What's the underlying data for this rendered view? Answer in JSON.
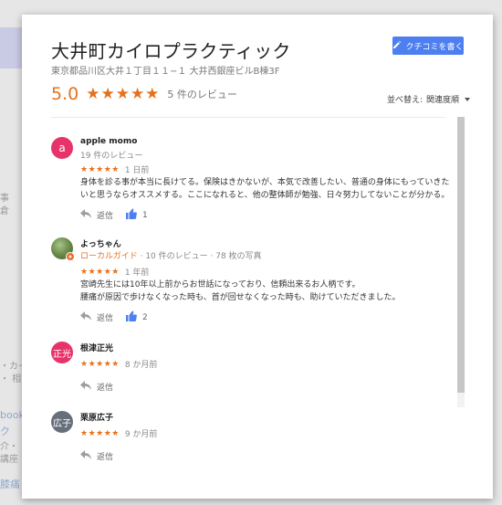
{
  "background": {
    "frag1": "事",
    "frag2": "倉",
    "frag3": "・カイ",
    "frag4": "・ 相",
    "frag5": "book",
    "frag6": "ク",
    "frag7": "介・ ・",
    "frag8": "講座",
    "frag9": "膝痛"
  },
  "business": {
    "name": "大井町カイロプラクティック",
    "address": "東京都品川区大井１丁目１１−１ 大井西銀座ビルB棟3F",
    "rating": "5.0",
    "stars": "★★★★★",
    "review_count": "5 件のレビュー"
  },
  "write_button": {
    "label": "クチコミを書く",
    "icon": "pencil-icon"
  },
  "sort": {
    "label": "並べ替え:",
    "value": "関連度順"
  },
  "reviews": [
    {
      "initial": "a",
      "avatar_color": "#e8336a",
      "name": "apple momo",
      "meta": "19 件のレビュー",
      "stars": "★★★★★",
      "time": "1 日前",
      "text": "身体を診る事が本当に長けてる。保険はきかないが、本気で改善したい、普通の身体にもっていきたいと思うならオススメする。ここになれると、他の整体師が勉強、日々努力してないことが分かる。",
      "reply": "返信",
      "likes": "1"
    },
    {
      "name": "よっちゃん",
      "guide": "ローカルガイド",
      "meta": "· 10 件のレビュー · 78 枚の写真",
      "stars": "★★★★★",
      "time": "1 年前",
      "text_line1": "宮崎先生には10年以上前からお世話になっており、信頼出来るお人柄です。",
      "text_line2": "腰痛が原因で歩けなくなった時も、首が回せなくなった時も、助けていただきました。",
      "reply": "返信",
      "likes": "2"
    },
    {
      "initial": "正光",
      "avatar_color": "#e8336a",
      "name": "根津正光",
      "stars": "★★★★★",
      "time": "8 か月前",
      "reply": "返信"
    },
    {
      "initial": "広子",
      "avatar_color": "#67707a",
      "name": "栗原広子",
      "stars": "★★★★★",
      "time": "9 か月前",
      "reply": "返信"
    }
  ]
}
